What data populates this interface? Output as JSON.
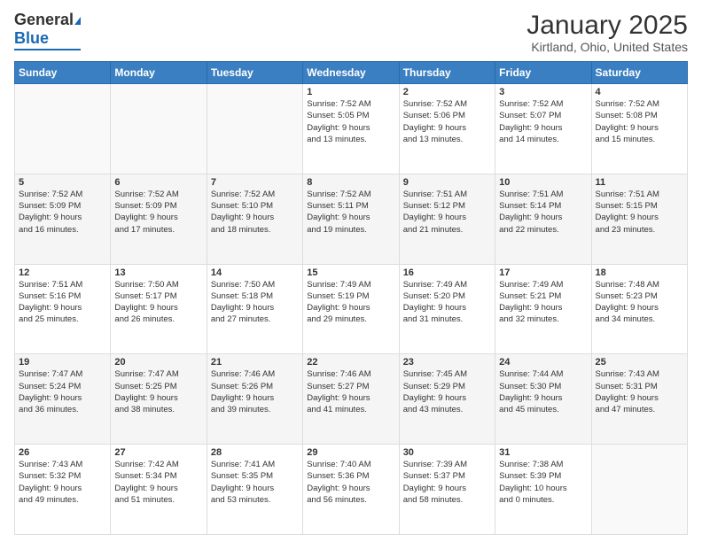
{
  "header": {
    "logo_general": "General",
    "logo_blue": "Blue",
    "title": "January 2025",
    "subtitle": "Kirtland, Ohio, United States"
  },
  "weekdays": [
    "Sunday",
    "Monday",
    "Tuesday",
    "Wednesday",
    "Thursday",
    "Friday",
    "Saturday"
  ],
  "weeks": [
    [
      {
        "day": "",
        "info": ""
      },
      {
        "day": "",
        "info": ""
      },
      {
        "day": "",
        "info": ""
      },
      {
        "day": "1",
        "info": "Sunrise: 7:52 AM\nSunset: 5:05 PM\nDaylight: 9 hours\nand 13 minutes."
      },
      {
        "day": "2",
        "info": "Sunrise: 7:52 AM\nSunset: 5:06 PM\nDaylight: 9 hours\nand 13 minutes."
      },
      {
        "day": "3",
        "info": "Sunrise: 7:52 AM\nSunset: 5:07 PM\nDaylight: 9 hours\nand 14 minutes."
      },
      {
        "day": "4",
        "info": "Sunrise: 7:52 AM\nSunset: 5:08 PM\nDaylight: 9 hours\nand 15 minutes."
      }
    ],
    [
      {
        "day": "5",
        "info": "Sunrise: 7:52 AM\nSunset: 5:09 PM\nDaylight: 9 hours\nand 16 minutes."
      },
      {
        "day": "6",
        "info": "Sunrise: 7:52 AM\nSunset: 5:09 PM\nDaylight: 9 hours\nand 17 minutes."
      },
      {
        "day": "7",
        "info": "Sunrise: 7:52 AM\nSunset: 5:10 PM\nDaylight: 9 hours\nand 18 minutes."
      },
      {
        "day": "8",
        "info": "Sunrise: 7:52 AM\nSunset: 5:11 PM\nDaylight: 9 hours\nand 19 minutes."
      },
      {
        "day": "9",
        "info": "Sunrise: 7:51 AM\nSunset: 5:12 PM\nDaylight: 9 hours\nand 21 minutes."
      },
      {
        "day": "10",
        "info": "Sunrise: 7:51 AM\nSunset: 5:14 PM\nDaylight: 9 hours\nand 22 minutes."
      },
      {
        "day": "11",
        "info": "Sunrise: 7:51 AM\nSunset: 5:15 PM\nDaylight: 9 hours\nand 23 minutes."
      }
    ],
    [
      {
        "day": "12",
        "info": "Sunrise: 7:51 AM\nSunset: 5:16 PM\nDaylight: 9 hours\nand 25 minutes."
      },
      {
        "day": "13",
        "info": "Sunrise: 7:50 AM\nSunset: 5:17 PM\nDaylight: 9 hours\nand 26 minutes."
      },
      {
        "day": "14",
        "info": "Sunrise: 7:50 AM\nSunset: 5:18 PM\nDaylight: 9 hours\nand 27 minutes."
      },
      {
        "day": "15",
        "info": "Sunrise: 7:49 AM\nSunset: 5:19 PM\nDaylight: 9 hours\nand 29 minutes."
      },
      {
        "day": "16",
        "info": "Sunrise: 7:49 AM\nSunset: 5:20 PM\nDaylight: 9 hours\nand 31 minutes."
      },
      {
        "day": "17",
        "info": "Sunrise: 7:49 AM\nSunset: 5:21 PM\nDaylight: 9 hours\nand 32 minutes."
      },
      {
        "day": "18",
        "info": "Sunrise: 7:48 AM\nSunset: 5:23 PM\nDaylight: 9 hours\nand 34 minutes."
      }
    ],
    [
      {
        "day": "19",
        "info": "Sunrise: 7:47 AM\nSunset: 5:24 PM\nDaylight: 9 hours\nand 36 minutes."
      },
      {
        "day": "20",
        "info": "Sunrise: 7:47 AM\nSunset: 5:25 PM\nDaylight: 9 hours\nand 38 minutes."
      },
      {
        "day": "21",
        "info": "Sunrise: 7:46 AM\nSunset: 5:26 PM\nDaylight: 9 hours\nand 39 minutes."
      },
      {
        "day": "22",
        "info": "Sunrise: 7:46 AM\nSunset: 5:27 PM\nDaylight: 9 hours\nand 41 minutes."
      },
      {
        "day": "23",
        "info": "Sunrise: 7:45 AM\nSunset: 5:29 PM\nDaylight: 9 hours\nand 43 minutes."
      },
      {
        "day": "24",
        "info": "Sunrise: 7:44 AM\nSunset: 5:30 PM\nDaylight: 9 hours\nand 45 minutes."
      },
      {
        "day": "25",
        "info": "Sunrise: 7:43 AM\nSunset: 5:31 PM\nDaylight: 9 hours\nand 47 minutes."
      }
    ],
    [
      {
        "day": "26",
        "info": "Sunrise: 7:43 AM\nSunset: 5:32 PM\nDaylight: 9 hours\nand 49 minutes."
      },
      {
        "day": "27",
        "info": "Sunrise: 7:42 AM\nSunset: 5:34 PM\nDaylight: 9 hours\nand 51 minutes."
      },
      {
        "day": "28",
        "info": "Sunrise: 7:41 AM\nSunset: 5:35 PM\nDaylight: 9 hours\nand 53 minutes."
      },
      {
        "day": "29",
        "info": "Sunrise: 7:40 AM\nSunset: 5:36 PM\nDaylight: 9 hours\nand 56 minutes."
      },
      {
        "day": "30",
        "info": "Sunrise: 7:39 AM\nSunset: 5:37 PM\nDaylight: 9 hours\nand 58 minutes."
      },
      {
        "day": "31",
        "info": "Sunrise: 7:38 AM\nSunset: 5:39 PM\nDaylight: 10 hours\nand 0 minutes."
      },
      {
        "day": "",
        "info": ""
      }
    ]
  ]
}
